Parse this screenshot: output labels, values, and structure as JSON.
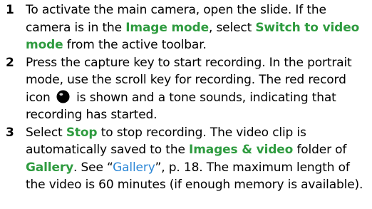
{
  "colors": {
    "highlight": "#2e9b3f",
    "link": "#2b86d6",
    "text": "#000000"
  },
  "steps": [
    {
      "number": "1",
      "t1": "To activate the main camera, open the slide. If the camera is in the ",
      "b1": "Image mode",
      "t2": ", select ",
      "b2": "Switch to video mode",
      "t3": " from the active toolbar."
    },
    {
      "number": "2",
      "t1": "Press the capture key to start recording. In the portrait mode, use the scroll key for recording. The red record icon ",
      "icon": "record-icon",
      "t2": " is shown and a tone sounds, indicating that recording has started."
    },
    {
      "number": "3",
      "t1": "Select ",
      "b1": "Stop",
      "t2": " to stop recording. The video clip is automatically saved to the ",
      "b2": "Images & video",
      "t3": " folder of ",
      "b3": "Gallery",
      "t4": ". See “",
      "link": "Gallery",
      "t5": "”, p. 18. The maximum length of the video is 60 minutes (if enough memory is available)."
    }
  ]
}
